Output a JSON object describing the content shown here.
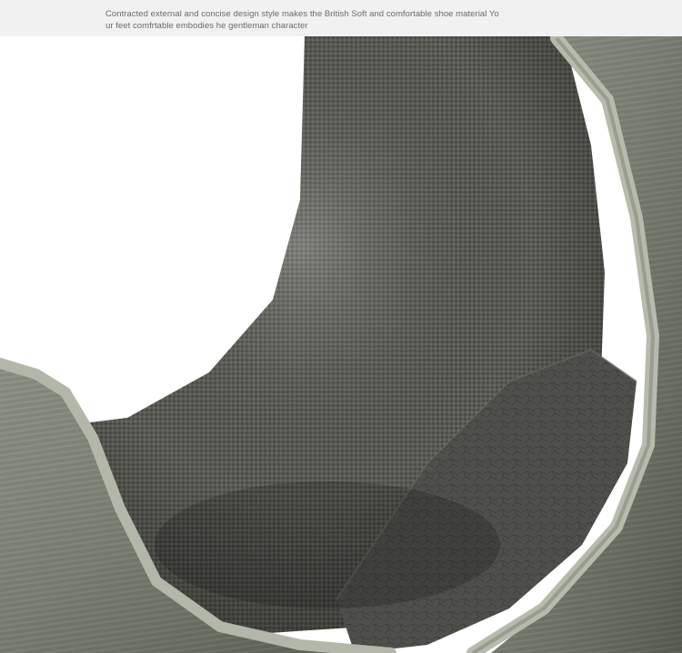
{
  "caption": {
    "line1": "Contracted external and concise design style makes the British Soft and comfortable shoe material Yo",
    "line2": "ur feet comfrtable embodies he gentleman character"
  },
  "photo": {
    "subject": "shoe-interior",
    "colors": {
      "background": "#ffffff",
      "mesh_lining": "#5a5b54",
      "mesh_light": "#8a8b82",
      "collar_fabric": "#6f7567",
      "collar_edge": "#b9bdae",
      "insole": "#4d4d49"
    }
  }
}
